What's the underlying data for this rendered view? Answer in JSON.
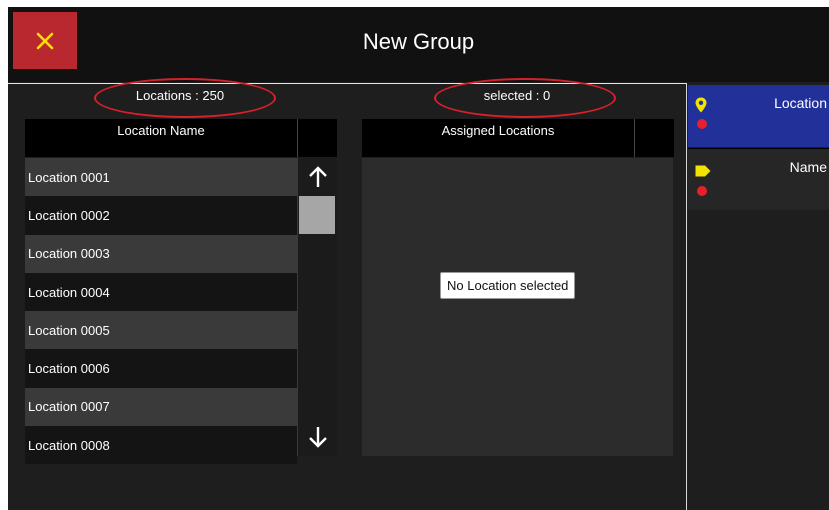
{
  "header": {
    "title": "New Group",
    "close_icon": "close-icon"
  },
  "counts": {
    "locations_label": "Locations : 250",
    "selected_label": "selected : 0"
  },
  "columns": {
    "location_name": "Location Name",
    "assigned_locations": "Assigned Locations"
  },
  "locations": [
    "Location 0001",
    "Location 0002",
    "Location 0003",
    "Location 0004",
    "Location 0005",
    "Location 0006",
    "Location 0007",
    "Location 0008"
  ],
  "assigned": {
    "empty_message": "No Location selected"
  },
  "side_tabs": [
    {
      "label": "Location",
      "icon": "map-pin-icon"
    },
    {
      "label": "Name",
      "icon": "tag-icon"
    }
  ],
  "colors": {
    "close_bg": "#b8282e",
    "active_tab": "#22309a",
    "annotation_red": "#d8202a",
    "pin_yellow": "#f2e400",
    "error_red": "#e8202a"
  }
}
